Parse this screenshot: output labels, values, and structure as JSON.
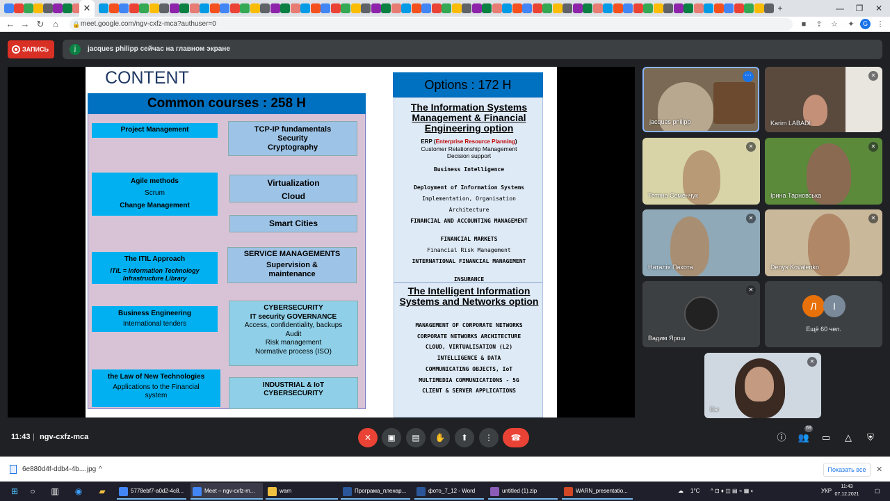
{
  "browser": {
    "url": "meet.google.com/ngv-cxfz-mca?authuser=0",
    "profile_initial": "G",
    "tab_close": "✕",
    "new_tab": "+"
  },
  "meet": {
    "record_label": "ЗАПИСЬ",
    "presenter_initial": "j",
    "presenting_text": "jacques philipp сейчас на главном экране",
    "time": "11:43",
    "separator": "|",
    "meeting_code": "ngv-cxfz-mca",
    "participants_badge": "69",
    "others_label": "Ещё 60 чел.",
    "others_initials": [
      "Л",
      "I"
    ]
  },
  "slide": {
    "title": "CONTENT",
    "common_heading": "Common courses : 258 H",
    "left_boxes": [
      {
        "lines": [
          "Project Management"
        ]
      },
      {
        "lines": [
          "Agile methods",
          "Scrum",
          "Change Management"
        ]
      },
      {
        "lines": [
          "The ITIL Approach",
          "ITIL = Information Technology Infrastructure Library"
        ]
      },
      {
        "lines": [
          "Business Engineering",
          "International tenders"
        ]
      },
      {
        "lines": [
          "the Law of New Technologies",
          "Applications to the Financial system"
        ]
      }
    ],
    "right_boxes": [
      {
        "lines": [
          "TCP-IP fundamentals",
          "Security",
          "Cryptography"
        ]
      },
      {
        "lines": [
          "Virtualization",
          "Cloud"
        ]
      },
      {
        "lines": [
          "Smart Cities"
        ]
      },
      {
        "lines": [
          "SERVICE MANAGEMENTS",
          "Supervision & maintenance"
        ]
      },
      {
        "lines": [
          "CYBERSECURITY",
          "IT security GOVERNANCE",
          "Access, confidentiality, backups",
          "Audit",
          "Risk management",
          "Normative process (ISO)"
        ]
      },
      {
        "lines": [
          "INDUSTRIAL & IoT CYBERSECURITY"
        ]
      }
    ],
    "options_heading": "Options : 172 H",
    "option1_title": "The Information Systems Management & Financial Engineering option",
    "option1_erp_prefix": "ERP (",
    "option1_erp_red": "Enterprise Resource Planning",
    "option1_erp_suffix": ")",
    "option1_lines": [
      "Customer Relationship Management",
      "Decision support",
      "Business Intelligence",
      "Deployment of Information Systems",
      "Implementation, Organisation",
      "Architecture",
      "FINANCIAL AND ACCOUNTING MANAGEMENT",
      "FINANCIAL MARKETS",
      "Financial Risk Management",
      "INTERNATIONAL FINANCIAL MANAGEMENT",
      "INSURANCE"
    ],
    "option2_title": "The Intelligent Information Systems and Networks option",
    "option2_lines": [
      "MANAGEMENT OF CORPORATE NETWORKS",
      "CORPORATE NETWORKS ARCHITECTURE",
      "CLOUD, VIRTUALISATION (L2)",
      "INTELLIGENCE & DATA",
      "COMMUNICATING OBJECTS, IoT",
      "MULTIMEDIA COMMUNICATIONS - 5G",
      "CLIENT & SERVER APPLICATIONS"
    ]
  },
  "participants": [
    {
      "name": "jacques philipp"
    },
    {
      "name": "Karim LABADI"
    },
    {
      "name": "Тетяна Семенчук"
    },
    {
      "name": "Ірина Тарновська"
    },
    {
      "name": "Наталія Пахота"
    },
    {
      "name": "Denys Kovalenko"
    },
    {
      "name": "Вадим Ярош"
    },
    {
      "name": "Вы"
    }
  ],
  "download": {
    "file_name": "6e880d4f-ddb4-4b....jpg",
    "show_all": "Показать все",
    "chevron": "^",
    "close": "✕"
  },
  "taskbar": {
    "apps": [
      "5778ebf7-a0d2-4c8...",
      "Meet – ngv-cxfz-m...",
      "warn",
      "Програма_пленар...",
      "фото_7_12 - Word",
      "untitled (1).zip",
      "WARN_presentatio..."
    ],
    "temperature": "1°C",
    "lang": "УКР",
    "clock_time": "11:43",
    "clock_date": "07.12.2021"
  }
}
